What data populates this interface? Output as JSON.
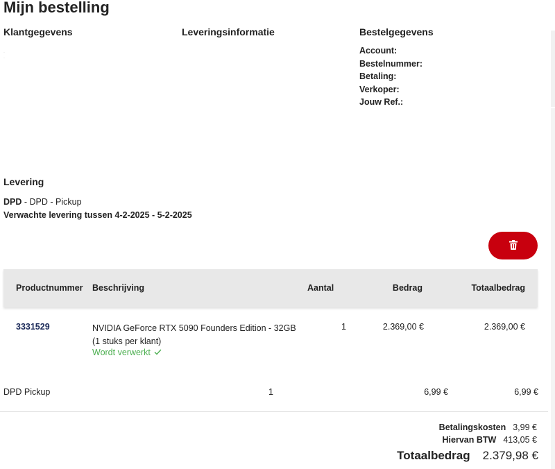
{
  "page": {
    "title": "Mijn bestelling"
  },
  "sections": {
    "klant_heading": "Klantgegevens",
    "levering_info_heading": "Leveringsinformatie",
    "bestel_heading": "Bestelgegevens"
  },
  "bestelgegevens": {
    "account_label": "Account:",
    "bestelnummer_label": "Bestelnummer:",
    "betaling_label": "Betaling:",
    "verkoper_label": "Verkoper:",
    "jouw_ref_label": "Jouw Ref.:"
  },
  "levering": {
    "heading": "Levering",
    "carrier": "DPD",
    "service": " - DPD - Pickup",
    "expected": "Verwachte levering tussen 4-2-2025 - 5-2-2025"
  },
  "colors": {
    "accent": "#c8000e",
    "status_green": "#4caf50",
    "link": "#1b2a59"
  },
  "icons": {
    "delete": "trash-icon",
    "status": "check-icon"
  },
  "table": {
    "headers": {
      "productnummer": "Productnummer",
      "beschrijving": "Beschrijving",
      "aantal": "Aantal",
      "bedrag": "Bedrag",
      "totaalbedrag": "Totaalbedrag"
    },
    "rows": [
      {
        "productnummer": "3331529",
        "beschrijving": "NVIDIA GeForce RTX 5090 Founders Edition - 32GB (1 stuks per klant)",
        "status": "Wordt verwerkt",
        "aantal": "1",
        "bedrag": "2.369,00 €",
        "totaalbedrag": "2.369,00 €"
      }
    ]
  },
  "shipping": {
    "label": "DPD Pickup",
    "aantal": "1",
    "bedrag": "6,99 €",
    "totaalbedrag": "6,99 €"
  },
  "summary": {
    "betalingskosten_label": "Betalingskosten",
    "betalingskosten_value": "3,99 €",
    "btw_label": "Hiervan BTW",
    "btw_value": "413,05 €",
    "totaal_label": "Totaalbedrag",
    "totaal_value": "2.379,98 €"
  }
}
